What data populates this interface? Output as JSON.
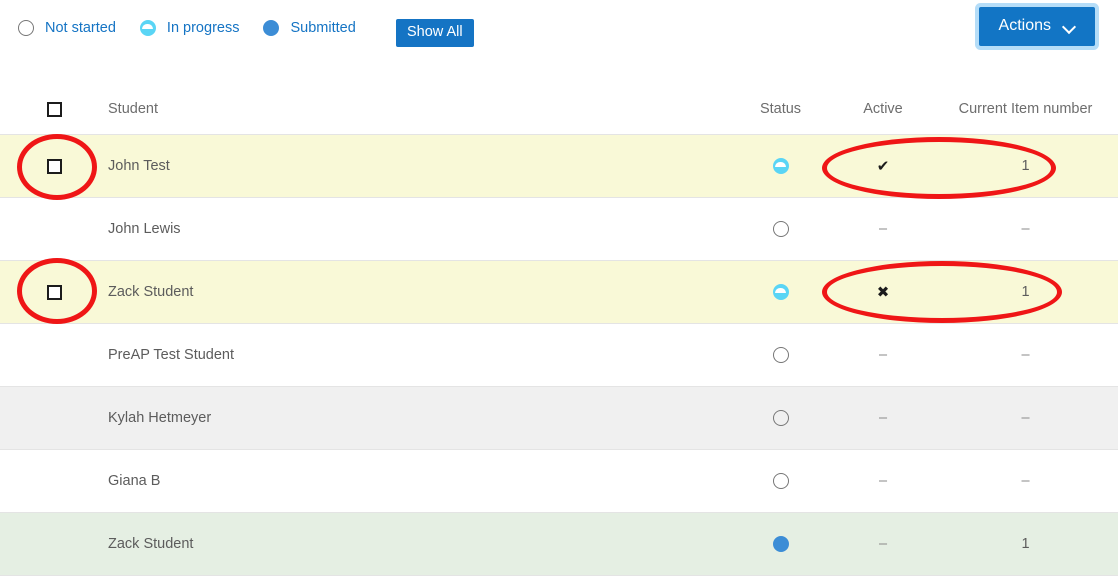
{
  "toolbar": {
    "legend": [
      {
        "label": "Not started",
        "icon": "circle-outline-icon",
        "state": "notstarted"
      },
      {
        "label": "In progress",
        "icon": "circle-half-filled-icon",
        "state": "inprogress"
      },
      {
        "label": "Submitted",
        "icon": "circle-filled-icon",
        "state": "submitted"
      }
    ],
    "show_all_label": "Show All",
    "actions_label": "Actions",
    "actions_chevron": "chevron-down-icon"
  },
  "table": {
    "headers": {
      "select_all": "select-all-checkbox",
      "student": "Student",
      "status": "Status",
      "active": "Active",
      "item": "Current Item number"
    },
    "rows": [
      {
        "name": "John Test",
        "status": "inprogress",
        "active": "✔",
        "item": "1",
        "bg": "yellow",
        "checkbox": true
      },
      {
        "name": "John Lewis",
        "status": "notstarted",
        "active": "–",
        "item": "–",
        "bg": "white",
        "checkbox": false
      },
      {
        "name": "Zack Student",
        "status": "inprogress",
        "active": "✖",
        "item": "1",
        "bg": "yellow",
        "checkbox": true
      },
      {
        "name": "PreAP Test Student",
        "status": "notstarted",
        "active": "–",
        "item": "–",
        "bg": "white",
        "checkbox": false
      },
      {
        "name": "Kylah Hetmeyer",
        "status": "notstarted",
        "active": "–",
        "item": "–",
        "bg": "grey",
        "checkbox": false
      },
      {
        "name": "Giana B",
        "status": "notstarted",
        "active": "–",
        "item": "–",
        "bg": "white",
        "checkbox": false
      },
      {
        "name": "Zack Student",
        "status": "submitted",
        "active": "–",
        "item": "1",
        "bg": "green",
        "checkbox": false
      }
    ]
  },
  "annotations": {
    "color": "#ef1616",
    "shapes": [
      {
        "name": "highlight-checkbox-row1",
        "type": "ellipse"
      },
      {
        "name": "highlight-checkbox-row3",
        "type": "ellipse"
      },
      {
        "name": "highlight-active-item-row1",
        "type": "ellipse"
      },
      {
        "name": "highlight-active-item-row3",
        "type": "ellipse"
      }
    ]
  },
  "colors": {
    "accent_blue": "#1574c4",
    "row_yellow": "#f9f9d7",
    "row_grey": "#f0f0f0",
    "row_green": "#e5efe3",
    "status_inprogress": "#5ad5f5",
    "status_submitted": "#3c8dd6",
    "annotation_red": "#ef1616"
  }
}
